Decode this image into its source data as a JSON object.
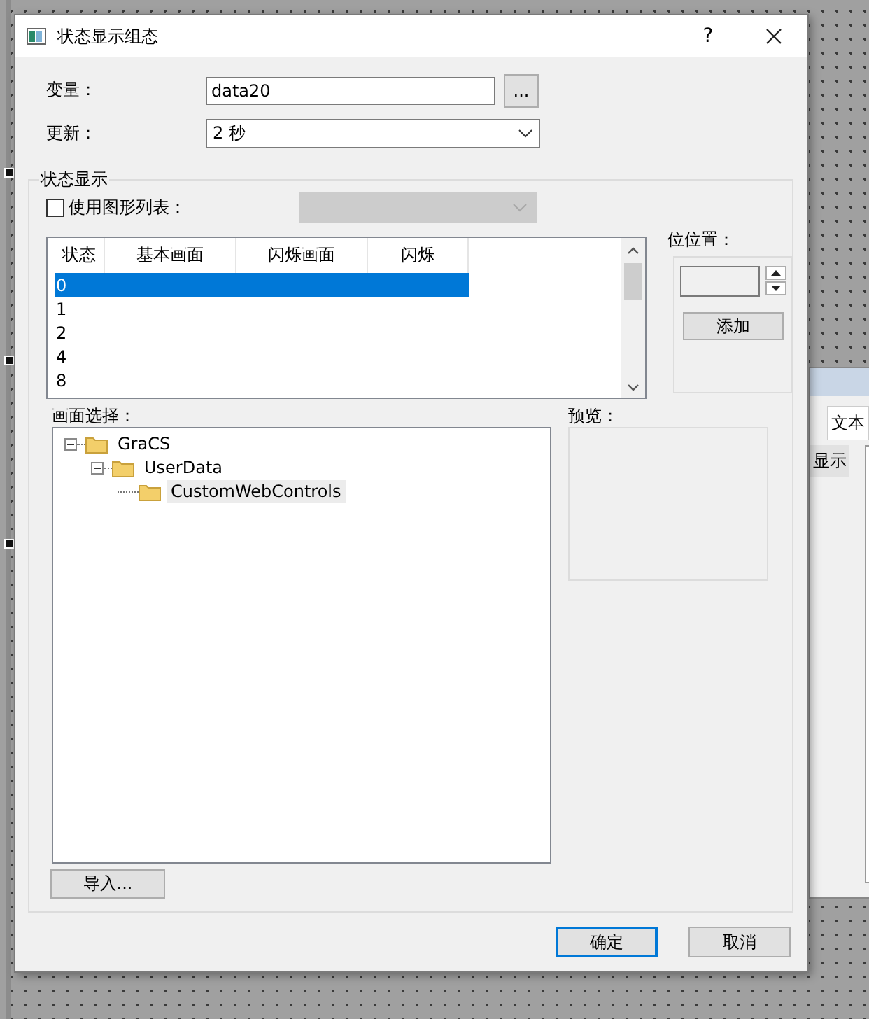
{
  "window": {
    "title": "状态显示组态",
    "help": "?"
  },
  "variable": {
    "label": "变量：",
    "value": "data20",
    "browse": "..."
  },
  "update": {
    "label": "更新：",
    "value": "2 秒"
  },
  "status_group": {
    "title": "状态显示",
    "use_graphic_list": {
      "label": "使用图形列表：",
      "checked": false
    },
    "graphic_list": {
      "disabled": true
    },
    "table": {
      "columns": [
        "状态",
        "基本画面",
        "闪烁画面",
        "闪烁"
      ],
      "rows": [
        {
          "state": "0",
          "selected": true
        },
        {
          "state": "1",
          "selected": false
        },
        {
          "state": "2",
          "selected": false
        },
        {
          "state": "4",
          "selected": false
        },
        {
          "state": "8",
          "selected": false
        }
      ]
    },
    "bit_position": {
      "label": "位位置：",
      "add_button": "添加"
    },
    "picture_selection": {
      "label": "画面选择：",
      "tree": [
        {
          "label": "GraCS",
          "expanded": true,
          "selected": false,
          "children": [
            {
              "label": "UserData",
              "expanded": true,
              "selected": false,
              "children": [
                {
                  "label": "CustomWebControls",
                  "selected": false,
                  "highlighted": true
                }
              ]
            }
          ]
        }
      ]
    },
    "preview": {
      "label": "预览："
    },
    "import_button": "导入..."
  },
  "buttons": [
    {
      "label": "确定",
      "default": true
    },
    {
      "label": "取消",
      "default": false
    }
  ],
  "background_window": {
    "tab": "文本",
    "item": "显示"
  }
}
